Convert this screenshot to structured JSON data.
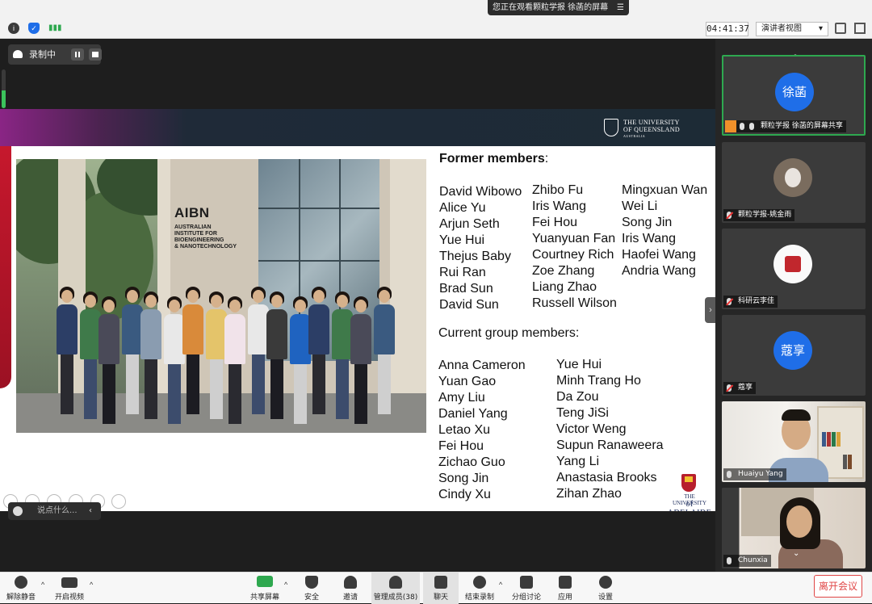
{
  "top": {
    "share_banner": "您正在观看颗粒学报 徐菡的屏幕",
    "timer": "04:41:37",
    "view_mode": "演讲者视图"
  },
  "recording": {
    "label": "录制中",
    "mic_level": 0.45
  },
  "slide": {
    "header_logo_line1": "The University",
    "header_logo_line2": "of Queensland",
    "header_logo_line3": "AUSTRALIA",
    "photo_sign": "AIBN",
    "photo_sign_sub": "AUSTRALIAN\nINSTITUTE FOR\nBIOENGINEERING\n& NANOTECHNOLOGY",
    "former_title": "Former members",
    "former_colon": ":",
    "former_col1": [
      "David Wibowo",
      "Alice Yu",
      "Arjun Seth",
      "Yue Hui",
      "Thejus Baby",
      "Rui Ran",
      "Brad Sun",
      "David Sun"
    ],
    "former_col2": [
      "Zhibo Fu",
      "Iris Wang",
      "Fei Hou",
      "Yuanyuan Fan",
      "Courtney Rich",
      "Zoe Zhang",
      "Liang Zhao",
      "Russell Wilson"
    ],
    "former_col3": [
      "Mingxuan Wan",
      "Wei Li",
      "Song Jin",
      "Iris Wang",
      "Haofei Wang",
      "Andria Wang"
    ],
    "current_title": "Current group members:",
    "current_col1": [
      "Anna Cameron",
      "Yuan Gao",
      "Amy Liu",
      "Daniel Yang",
      "Letao Xu",
      "Fei Hou",
      "Zichao Guo",
      "Song Jin",
      "Cindy Xu"
    ],
    "current_col2": [
      "Yue Hui",
      "Minh Trang Ho",
      "Da Zou",
      "Teng JiSi",
      "Victor Weng",
      "Supun Ranaweera",
      "Yang Li",
      "Anastasia Brooks",
      "Zihan Zhao"
    ],
    "adelaide_line1": "THE UNIVERSITY",
    "adelaide_line2": "of ADELAIDE"
  },
  "chat": {
    "placeholder": "说点什么..."
  },
  "participants": [
    {
      "avatar_text": "徐菡",
      "label": "颗粒学报 徐菡的屏幕共享"
    },
    {
      "avatar_text": "",
      "label": "颗粒学报-姚金雨"
    },
    {
      "avatar_text": "",
      "label": "科研云李佳"
    },
    {
      "avatar_text": "蔻享",
      "label": "蔻享"
    },
    {
      "avatar_text": "",
      "label": "Huaiyu Yang"
    },
    {
      "avatar_text": "",
      "label": "Chunxia"
    }
  ],
  "toolbar": {
    "unmute": "解除静音",
    "start_video": "开启视频",
    "share_screen": "共享屏幕",
    "security": "安全",
    "invite": "邀请",
    "manage_members": "管理成员(38)",
    "chat": "聊天",
    "stop_recording": "结束录制",
    "breakout": "分组讨论",
    "apps": "应用",
    "settings": "设置",
    "leave": "离开会议"
  },
  "colors": {
    "accent_blue": "#1f6ee8",
    "leave_red": "#e04646",
    "active_green": "#2ea84f"
  }
}
